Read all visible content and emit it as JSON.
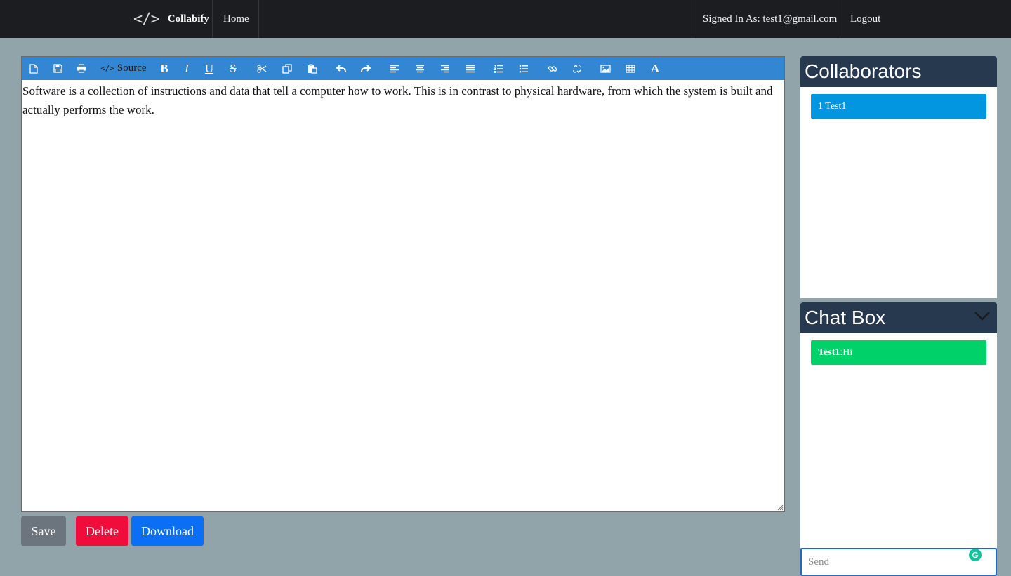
{
  "navbar": {
    "brand_icon": "</>",
    "brand_name": "Collabify",
    "home_label": "Home",
    "signed_in_label": "Signed In As: test1@gmail.com",
    "logout_label": "Logout"
  },
  "toolbar": {
    "source_label": "Source",
    "bold_label": "B",
    "italic_label": "I",
    "underline_label": "U",
    "strike_label": "S",
    "font_label": "A",
    "icons": [
      "new-page-icon",
      "save-icon",
      "print-icon",
      "source-icon",
      "bold-icon",
      "italic-icon",
      "underline-icon",
      "strikethrough-icon",
      "cut-icon",
      "copy-icon",
      "paste-icon",
      "undo-icon",
      "redo-icon",
      "align-left-icon",
      "align-center-icon",
      "align-right-icon",
      "justify-icon",
      "numbered-list-icon",
      "bulleted-list-icon",
      "link-icon",
      "unlink-icon",
      "image-icon",
      "table-icon",
      "font-color-icon"
    ]
  },
  "editor": {
    "content": "Software is a collection of instructions and data that tell a computer how to work. This is in contrast to physical hardware, from which the system is built and actually performs the work."
  },
  "actions": {
    "save_label": "Save",
    "delete_label": "Delete",
    "download_label": "Download"
  },
  "collaborators": {
    "title": "Collaborators",
    "items": [
      {
        "label": "1 Test1"
      }
    ]
  },
  "chat": {
    "title": "Chat Box",
    "messages": [
      {
        "sender": "Test1",
        "text": ":Hi"
      }
    ],
    "input_placeholder": "Send"
  },
  "colors": {
    "page_bg": "#90a4a9",
    "navbar_bg": "#1c1d20",
    "toolbar_bg": "#3386d1",
    "panel_header_bg": "#27394f",
    "collaborator_bg": "#0295e0",
    "chat_message_bg": "#00d26a",
    "save_bg": "#6c757d",
    "delete_bg": "#f00d3c",
    "download_bg": "#0a6ff5"
  }
}
